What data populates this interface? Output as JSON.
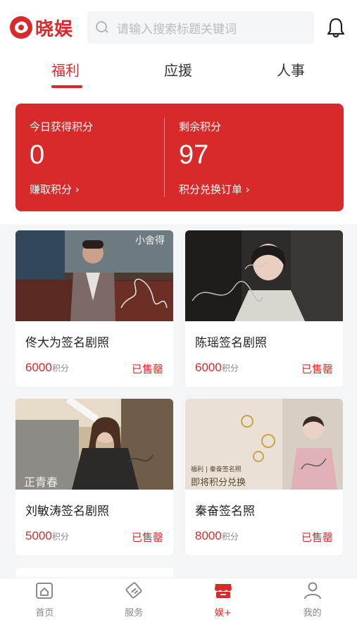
{
  "brand": {
    "name": "晓娱",
    "color": "#d82a2a"
  },
  "search": {
    "placeholder": "请输入搜索标题关键词",
    "icon": "search-icon"
  },
  "header_icons": {
    "bell": "bell-icon"
  },
  "tabs": [
    {
      "label": "福利",
      "active": true
    },
    {
      "label": "应援",
      "active": false
    },
    {
      "label": "人事",
      "active": false
    }
  ],
  "points": {
    "today_label": "今日获得积分",
    "today_value": "0",
    "today_link": "赚取积分",
    "remaining_label": "剩余积分",
    "remaining_value": "97",
    "remaining_link": "积分兑换订单"
  },
  "products": [
    {
      "title": "佟大为签名剧照",
      "price": "6000",
      "unit": "积分",
      "status": "已售罄"
    },
    {
      "title": "陈瑶签名剧照",
      "price": "6000",
      "unit": "积分",
      "status": "已售罄"
    },
    {
      "title": "刘敏涛签名剧照",
      "price": "5000",
      "unit": "积分",
      "status": "已售罄"
    },
    {
      "title": "秦奋签名照",
      "price": "8000",
      "unit": "积分",
      "status": "已售罄"
    }
  ],
  "photo_text": {
    "photo1_caption": "小舍得",
    "photo3_caption": "正青春",
    "photo4_line1": "福利 | 秦奋签名照",
    "photo4_line2": "即将积分兑换"
  },
  "bottom_nav": [
    {
      "label": "首页",
      "icon": "home-icon",
      "active": false
    },
    {
      "label": "服务",
      "icon": "service-icon",
      "active": false
    },
    {
      "label": "娱+",
      "icon": "shop-icon",
      "active": true
    },
    {
      "label": "我的",
      "icon": "user-icon",
      "active": false
    }
  ]
}
